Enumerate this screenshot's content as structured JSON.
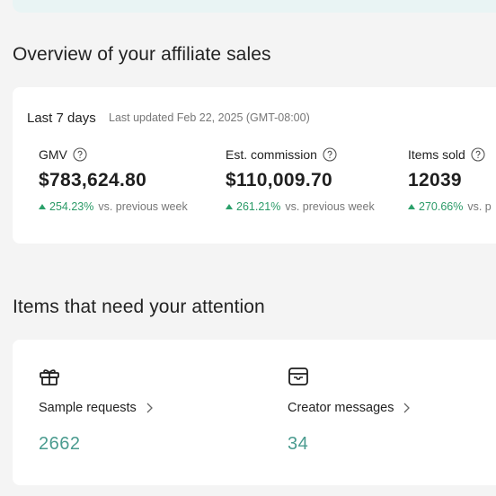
{
  "overview": {
    "title": "Overview of your affiliate sales",
    "period": "Last 7 days",
    "last_updated": "Last updated Feb 22, 2025 (GMT-08:00)",
    "metrics": [
      {
        "label": "GMV",
        "value": "$783,624.80",
        "change": "254.23%",
        "compare": "vs. previous week"
      },
      {
        "label": "Est. commission",
        "value": "$110,009.70",
        "change": "261.21%",
        "compare": "vs. previous week"
      },
      {
        "label": "Items sold",
        "value": "12039",
        "change": "270.66%",
        "compare": "vs. p"
      }
    ]
  },
  "attention": {
    "title": "Items that need your attention",
    "items": [
      {
        "label": "Sample requests",
        "value": "2662",
        "icon": "gift-icon"
      },
      {
        "label": "Creator messages",
        "value": "34",
        "icon": "message-box-icon"
      }
    ]
  },
  "colors": {
    "accent_green": "#2a9a67",
    "teal_value": "#4a9b8f",
    "banner": "#e9f4f4"
  }
}
